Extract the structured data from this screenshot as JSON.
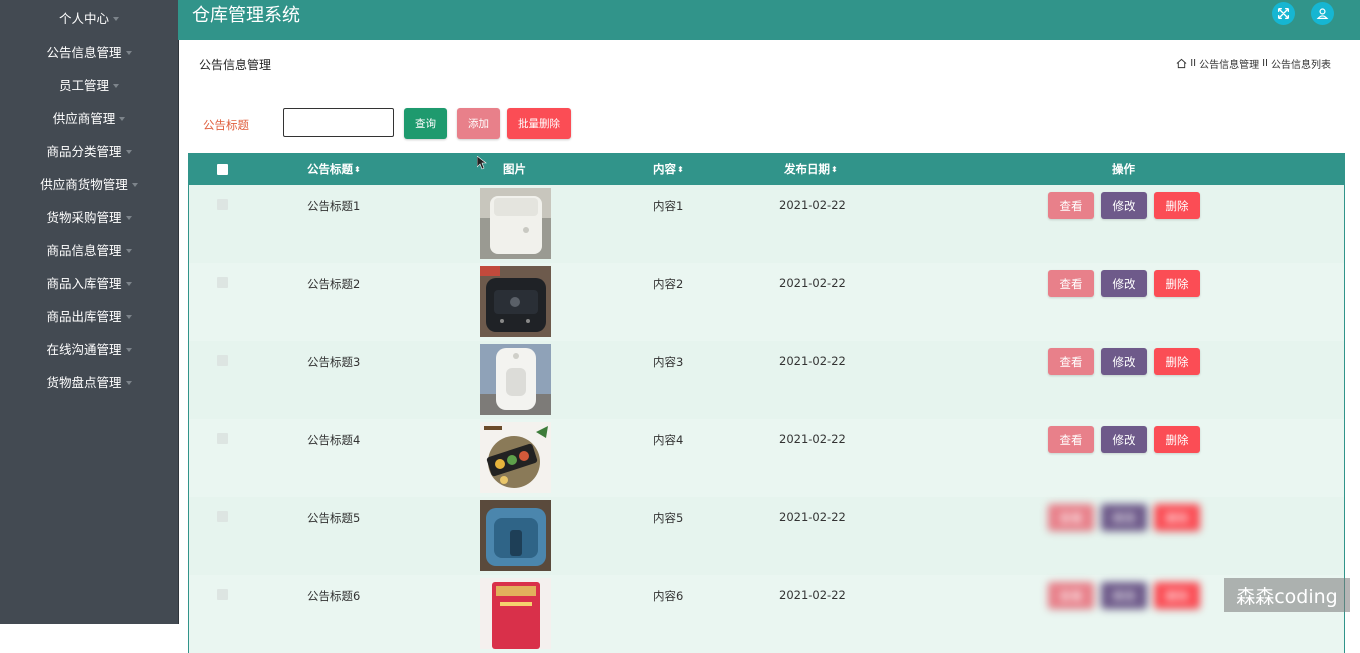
{
  "sidebar": {
    "items": [
      {
        "label": "个人中心"
      },
      {
        "label": "公告信息管理"
      },
      {
        "label": "员工管理"
      },
      {
        "label": "供应商管理"
      },
      {
        "label": "商品分类管理"
      },
      {
        "label": "供应商货物管理"
      },
      {
        "label": "货物采购管理"
      },
      {
        "label": "商品信息管理"
      },
      {
        "label": "商品入库管理"
      },
      {
        "label": "商品出库管理"
      },
      {
        "label": "在线沟通管理"
      },
      {
        "label": "货物盘点管理"
      }
    ]
  },
  "header": {
    "title": "仓库管理系统",
    "icons": [
      "fullscreen-icon",
      "user-icon"
    ]
  },
  "page": {
    "heading": "公告信息管理",
    "breadcrumb": [
      "公告信息管理",
      "公告信息列表"
    ],
    "breadcrumb_sep": "II"
  },
  "search": {
    "label": "公告标题",
    "value": "",
    "query_label": "查询",
    "add_label": "添加",
    "batch_delete_label": "批量删除"
  },
  "table": {
    "headers": {
      "title": "公告标题",
      "image": "图片",
      "content": "内容",
      "date": "发布日期",
      "actions": "操作"
    },
    "action_labels": {
      "view": "查看",
      "edit": "修改",
      "delete": "删除"
    },
    "rows": [
      {
        "title": "公告标题1",
        "content": "内容1",
        "date": "2021-02-22",
        "image": "white-rice-cooker"
      },
      {
        "title": "公告标题2",
        "content": "内容2",
        "date": "2021-02-22",
        "image": "black-cooker-panel"
      },
      {
        "title": "公告标题3",
        "content": "内容3",
        "date": "2021-02-22",
        "image": "white-air-fryer"
      },
      {
        "title": "公告标题4",
        "content": "内容4",
        "date": "2021-02-22",
        "image": "mooncake-plate"
      },
      {
        "title": "公告标题5",
        "content": "内容5",
        "date": "2021-02-22",
        "image": "blue-appliance"
      },
      {
        "title": "公告标题6",
        "content": "内容6",
        "date": "2021-02-22",
        "image": "red-package"
      }
    ]
  },
  "colors": {
    "sidebar_bg": "#434a52",
    "topbar_bg": "#31948a",
    "query": "#1e9a6e",
    "add": "#e8808a",
    "danger": "#fb4d55",
    "edit": "#6e5a8a",
    "row_bg": "#e6f4ee"
  },
  "watermark": "森森coding"
}
